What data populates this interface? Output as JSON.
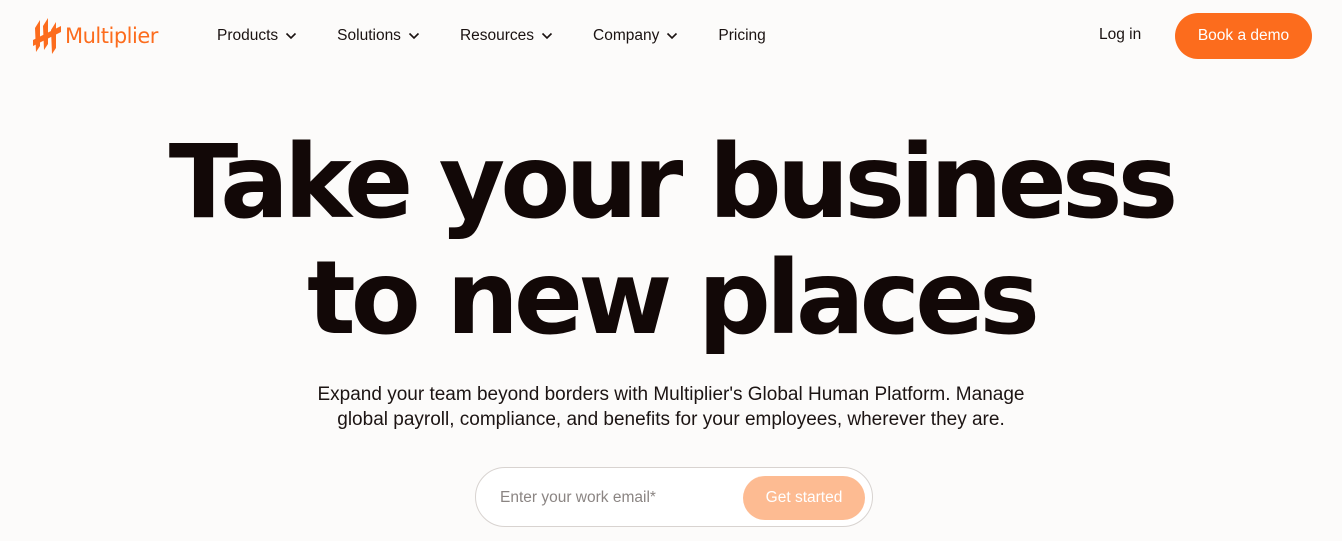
{
  "brand": {
    "name": "Multiplier",
    "logo_icon": "multiplier-logo-icon",
    "accent_color": "#fc6c1d"
  },
  "nav": {
    "items": [
      {
        "label": "Products",
        "icon": "chevron-down-icon"
      },
      {
        "label": "Solutions",
        "icon": "chevron-down-icon"
      },
      {
        "label": "Resources",
        "icon": "chevron-down-icon"
      },
      {
        "label": "Company",
        "icon": "chevron-down-icon"
      },
      {
        "label": "Pricing"
      }
    ],
    "login_label": "Log in",
    "demo_label": "Book a demo"
  },
  "hero": {
    "headline_line1": "Take your business",
    "headline_line2": "to new places",
    "subtext_line1": "Expand your team beyond borders with Multiplier's Global Human Platform. Manage",
    "subtext_line2": "global payroll, compliance, and benefits for your employees, wherever they are."
  },
  "signup": {
    "email_placeholder": "Enter your work email*",
    "email_value": "",
    "button_label": "Get started",
    "button_color": "#fdbb92"
  }
}
